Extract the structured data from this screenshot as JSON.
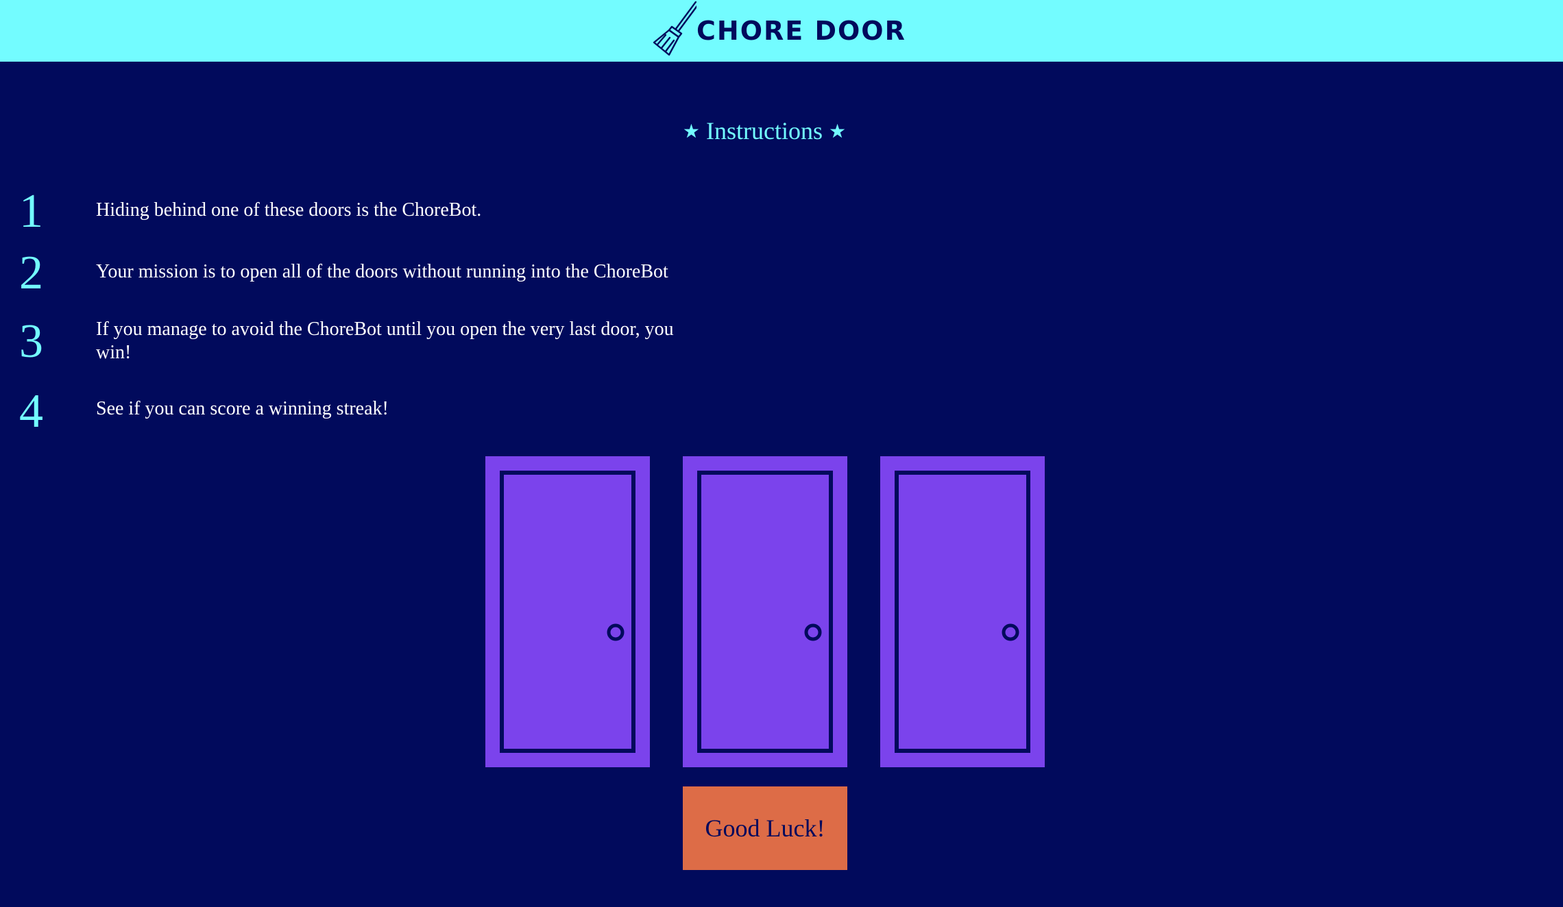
{
  "header": {
    "title": "CHORE DOOR",
    "logo_icon": "broom-icon",
    "background": "#73fcff",
    "text_color": "#010a5c"
  },
  "instructions": {
    "heading": "Instructions",
    "star_glyph": "★",
    "color": "#73fcff",
    "steps": [
      {
        "number": "1",
        "text": "Hiding behind one of these doors is the ChoreBot."
      },
      {
        "number": "2",
        "text": "Your mission is to open all of the doors without running into the ChoreBot"
      },
      {
        "number": "3",
        "text": "If you manage to avoid the ChoreBot until you open the very last door, you win!"
      },
      {
        "number": "4",
        "text": "See if you can score a winning streak!"
      }
    ]
  },
  "doors": [
    {
      "icon": "closed-door-icon",
      "state": "closed"
    },
    {
      "icon": "closed-door-icon",
      "state": "closed"
    },
    {
      "icon": "closed-door-icon",
      "state": "closed"
    }
  ],
  "start_button": {
    "label": "Good Luck!",
    "background": "#dd6c47"
  },
  "colors": {
    "page_background": "#010a5c",
    "door": "#7b43ec",
    "door_outline": "#010a5c",
    "step_text": "#ffffff"
  }
}
